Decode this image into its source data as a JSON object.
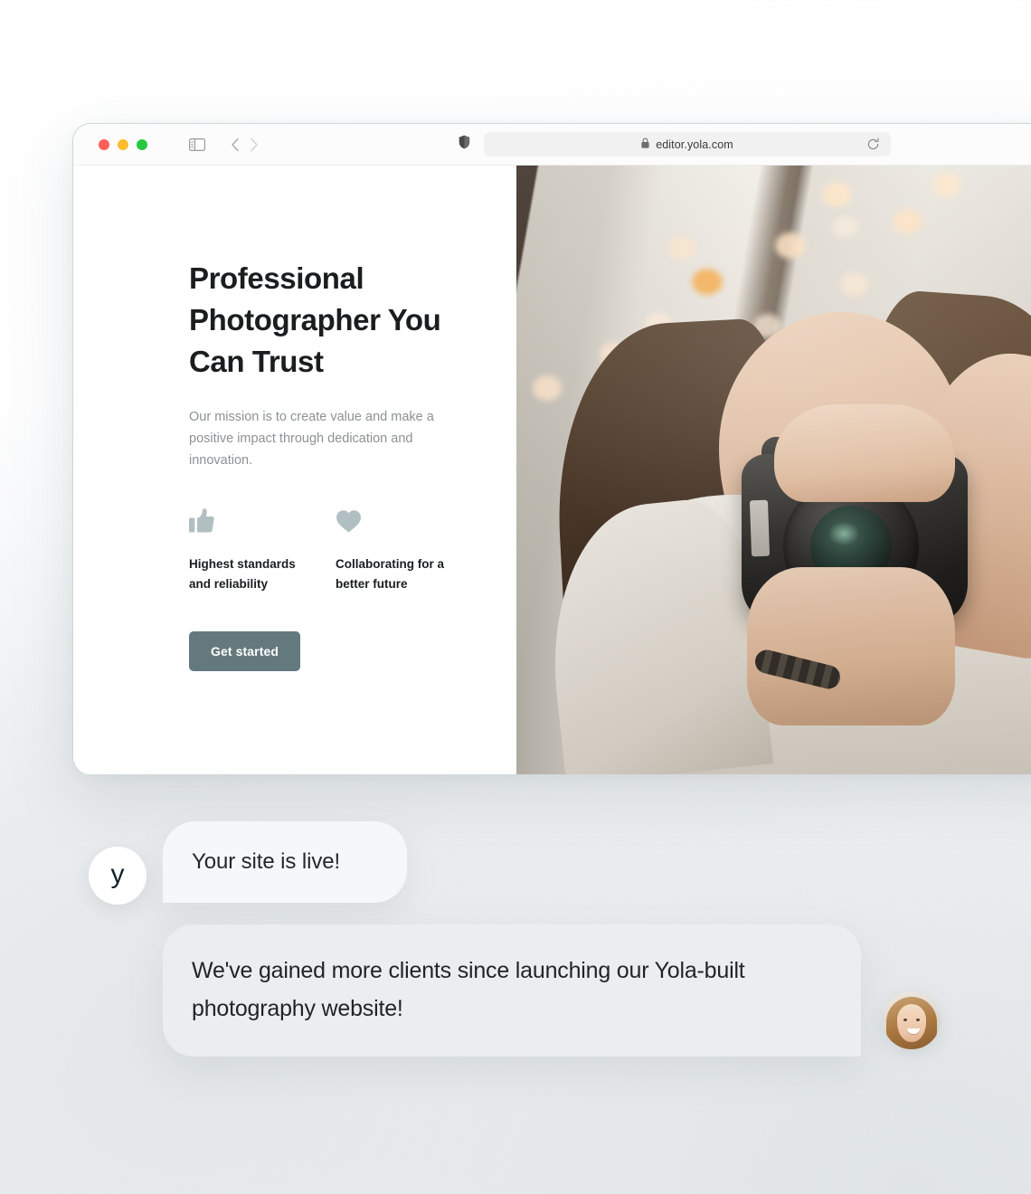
{
  "browser": {
    "traffic_lights": [
      "close",
      "minimize",
      "maximize"
    ],
    "icons": {
      "sidebar": "sidebar-toggle-icon",
      "back": "chevron-left-icon",
      "forward": "chevron-right-icon",
      "shield": "privacy-shield-icon",
      "lock": "lock-icon",
      "reload": "reload-icon"
    },
    "url": "editor.yola.com"
  },
  "hero": {
    "headline": "Professional Photographer You Can Trust",
    "subcopy": "Our mission is to create value and make a positive impact through dedication and innovation.",
    "features": [
      {
        "icon": "thumbs-up-icon",
        "label": "Highest standards and reliability"
      },
      {
        "icon": "heart-icon",
        "label": "Collaborating for a better future"
      }
    ],
    "cta_label": "Get started",
    "photo_alt": "Photographer holding a Canon DSLR camera in front of her face with bokeh string lights behind"
  },
  "chat": {
    "logo_letter": "y",
    "messages": [
      {
        "from": "yola",
        "text": "Your site is live!"
      },
      {
        "from": "customer",
        "text": "We've gained more clients since launching our Yola-built photography website!"
      }
    ],
    "customer_avatar_alt": "Smiling woman with light brown hair"
  },
  "colors": {
    "cta_background": "#64797e",
    "feature_icon": "#b2bfc2",
    "bubble_light": "#f6f7f8",
    "bubble_gray": "#ebedef",
    "heading_text": "#1b1d1f",
    "body_text": "#8d9295",
    "traffic_red": "#ff5f57",
    "traffic_yellow": "#febc2e",
    "traffic_green": "#28c840"
  }
}
